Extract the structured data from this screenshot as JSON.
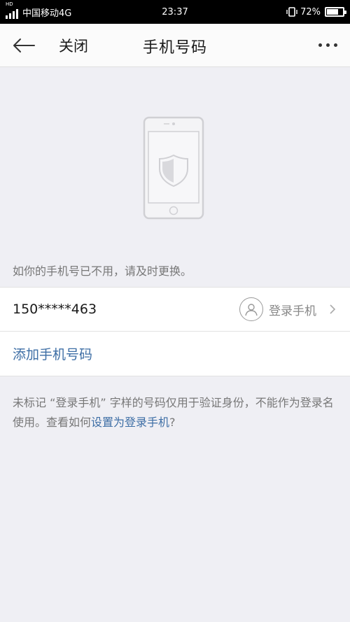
{
  "status_bar": {
    "network_badge": "HD",
    "carrier": "中国移动4G",
    "time": "23:37",
    "battery": "72%",
    "battery_level": 0.72
  },
  "header": {
    "back_icon": "arrow-left-icon",
    "close_label": "关闭",
    "title": "手机号码",
    "more_icon": "more-dots-icon"
  },
  "illustration": {
    "icon": "phone-shield-icon"
  },
  "notice": "如你的手机号已不用，请及时更换。",
  "phone_entry": {
    "number": "150*****463",
    "tag_label": "登录手机",
    "tag_icon": "user-avatar-icon",
    "arrow_icon": "chevron-right-icon"
  },
  "add_phone_label": "添加手机号码",
  "footnote": {
    "text_before": "未标记 “登录手机” 字样的号码仅用于验证身份，不能作为登录名使用。查看如何",
    "link_text": "设置为登录手机",
    "text_after": "?"
  },
  "colors": {
    "link": "#3d6ea5",
    "background": "#efeff4",
    "header": "#fbfbfb"
  }
}
